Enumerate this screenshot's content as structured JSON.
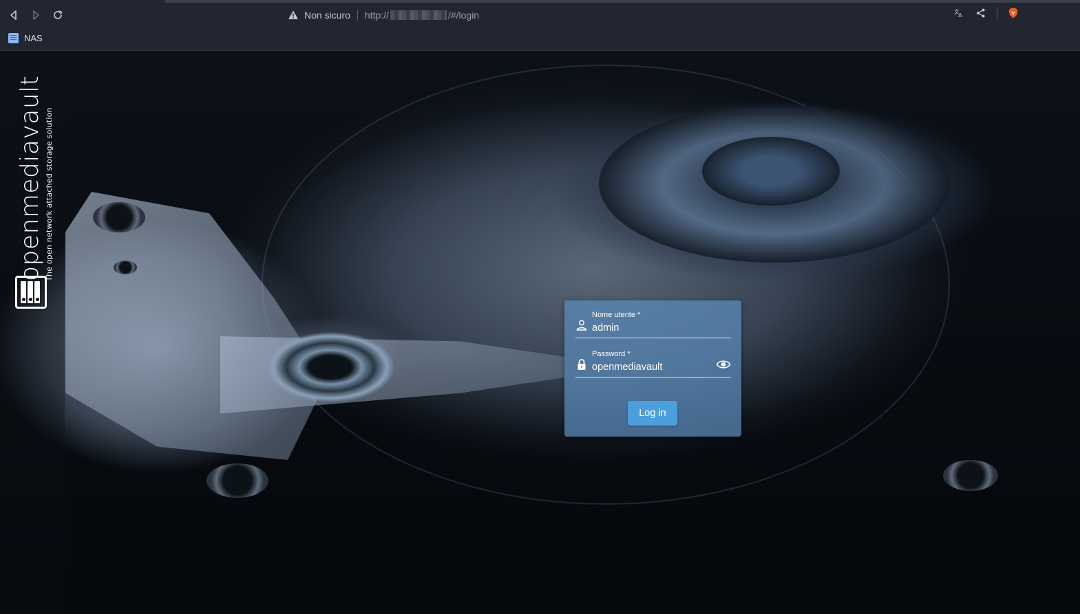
{
  "browser": {
    "security_label": "Non sicuro",
    "url_prefix": "http://",
    "url_suffix": "/#/login",
    "bookmark_label": "NAS"
  },
  "sidebar": {
    "brand_name": "openmediavault",
    "tagline": "The open network attached storage solution"
  },
  "login": {
    "username_label": "Nome utente *",
    "username_value": "admin",
    "password_label": "Password *",
    "password_value": "openmediavault",
    "submit_label": "Log in"
  },
  "icons": {
    "back": "back-arrow-icon",
    "forward": "forward-arrow-icon",
    "reload": "reload-icon",
    "warning": "warning-triangle-icon",
    "translate": "translate-icon",
    "share": "share-icon",
    "brave": "brave-lion-icon",
    "user": "person-icon",
    "lock": "lock-icon",
    "eye": "eye-icon"
  },
  "colors": {
    "card": "#5c8cbb",
    "button": "#4c9fdb",
    "chrome": "#222630"
  }
}
